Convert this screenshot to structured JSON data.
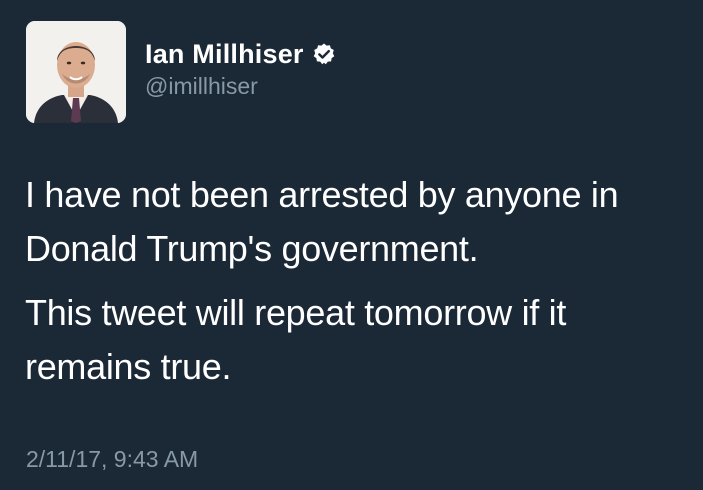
{
  "tweet": {
    "author": {
      "display_name": "Ian Millhiser",
      "handle": "@imillhiser",
      "verified": true,
      "avatar_icon": "profile-photo"
    },
    "paragraphs": [
      "I have not been arrested by anyone in Donald Trump's government.",
      "This tweet will repeat tomorrow if it remains true."
    ],
    "timestamp": "2/11/17, 9:43 AM"
  },
  "colors": {
    "background": "#1b2836",
    "text_primary": "#ffffff",
    "text_secondary": "#8899a6",
    "verified_badge": "#ffffff"
  }
}
